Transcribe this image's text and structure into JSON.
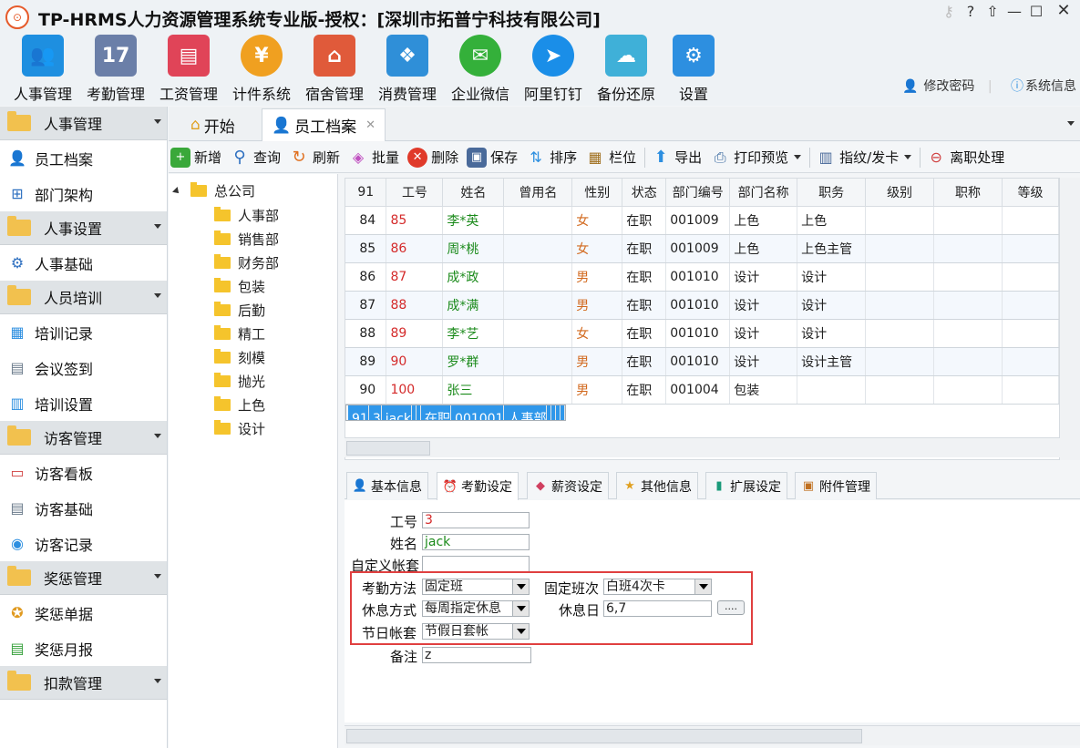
{
  "window": {
    "title": "TP-HRMS人力资源管理系统专业版-授权：[深圳市拓普宁科技有限公司]"
  },
  "modules": [
    {
      "label": "人事管理",
      "icon": "people-icon",
      "color": "#1e8fe0"
    },
    {
      "label": "考勤管理",
      "icon": "calendar-icon",
      "color": "#6b7fa8"
    },
    {
      "label": "工资管理",
      "icon": "payroll-icon",
      "color": "#e04458"
    },
    {
      "label": "计件系统",
      "icon": "moneybag-icon",
      "color": "#f0a020"
    },
    {
      "label": "宿舍管理",
      "icon": "house-icon",
      "color": "#e05a3a"
    },
    {
      "label": "消费管理",
      "icon": "cubes-icon",
      "color": "#2f8fd8"
    },
    {
      "label": "企业微信",
      "icon": "wechat-icon",
      "color": "#34b03a"
    },
    {
      "label": "阿里钉钉",
      "icon": "dingtalk-icon",
      "color": "#1a8ee8"
    },
    {
      "label": "备份还原",
      "icon": "cloud-icon",
      "color": "#3fb0d8"
    },
    {
      "label": "设置",
      "icon": "settings-icon",
      "color": "#2d8fe0"
    }
  ],
  "toplinks": {
    "change_password": "修改密码",
    "system_info": "系统信息"
  },
  "sidebar": {
    "groups": [
      {
        "label": "人事管理",
        "items": [
          {
            "label": "员工档案",
            "icon": "employee-icon"
          },
          {
            "label": "部门架构",
            "icon": "org-chart-icon"
          }
        ]
      },
      {
        "label": "人事设置",
        "items": [
          {
            "label": "人事基础",
            "icon": "gear-icon"
          }
        ]
      },
      {
        "label": "人员培训",
        "items": [
          {
            "label": "培训记录",
            "icon": "training-record-icon"
          },
          {
            "label": "会议签到",
            "icon": "meeting-icon"
          },
          {
            "label": "培训设置",
            "icon": "training-settings-icon"
          }
        ]
      },
      {
        "label": "访客管理",
        "items": [
          {
            "label": "访客看板",
            "icon": "visitor-board-icon"
          },
          {
            "label": "访客基础",
            "icon": "visitor-base-icon"
          },
          {
            "label": "访客记录",
            "icon": "visitor-record-icon"
          }
        ]
      },
      {
        "label": "奖惩管理",
        "items": [
          {
            "label": "奖惩单据",
            "icon": "award-icon"
          },
          {
            "label": "奖惩月报",
            "icon": "report-icon"
          }
        ]
      },
      {
        "label": "扣款管理",
        "items": []
      }
    ]
  },
  "tabs": [
    {
      "label": "开始"
    },
    {
      "label": "员工档案"
    }
  ],
  "toolbar": [
    {
      "label": "新增",
      "icon": "plus-icon"
    },
    {
      "label": "查询",
      "icon": "search-icon"
    },
    {
      "label": "刷新",
      "icon": "refresh-icon"
    },
    {
      "label": "批量",
      "icon": "tag-icon"
    },
    {
      "label": "删除",
      "icon": "delete-icon"
    },
    {
      "label": "保存",
      "icon": "save-icon"
    },
    {
      "label": "排序",
      "icon": "sort-icon"
    },
    {
      "label": "栏位",
      "icon": "columns-icon"
    },
    {
      "label": "导出",
      "icon": "export-icon"
    },
    {
      "label": "打印预览",
      "icon": "print-preview-icon"
    },
    {
      "label": "指纹/发卡",
      "icon": "fingerprint-icon"
    },
    {
      "label": "离职处理",
      "icon": "resign-icon"
    }
  ],
  "tree": {
    "root": "总公司",
    "children": [
      "人事部",
      "销售部",
      "财务部",
      "包装",
      "后勤",
      "精工",
      "刻模",
      "抛光",
      "上色",
      "设计"
    ]
  },
  "grid": {
    "headers": [
      "91",
      "工号",
      "姓名",
      "曾用名",
      "性别",
      "状态",
      "部门编号",
      "部门名称",
      "职务",
      "级别",
      "职称",
      "等级"
    ],
    "rows": [
      [
        "84",
        "85",
        "李*英",
        "",
        "女",
        "在职",
        "001009",
        "上色",
        "上色",
        "",
        "",
        ""
      ],
      [
        "85",
        "86",
        "周*桃",
        "",
        "女",
        "在职",
        "001009",
        "上色",
        "上色主管",
        "",
        "",
        ""
      ],
      [
        "86",
        "87",
        "成*政",
        "",
        "男",
        "在职",
        "001010",
        "设计",
        "设计",
        "",
        "",
        ""
      ],
      [
        "87",
        "88",
        "成*满",
        "",
        "男",
        "在职",
        "001010",
        "设计",
        "设计",
        "",
        "",
        ""
      ],
      [
        "88",
        "89",
        "李*艺",
        "",
        "女",
        "在职",
        "001010",
        "设计",
        "设计",
        "",
        "",
        ""
      ],
      [
        "89",
        "90",
        "罗*群",
        "",
        "男",
        "在职",
        "001010",
        "设计",
        "设计主管",
        "",
        "",
        ""
      ],
      [
        "90",
        "100",
        "张三",
        "",
        "男",
        "在职",
        "001004",
        "包装",
        "",
        "",
        "",
        ""
      ],
      [
        "91",
        "3",
        "jack",
        "",
        "",
        "在职",
        "001001",
        "人事部",
        "",
        "",
        "",
        ""
      ]
    ]
  },
  "subtabs": [
    {
      "label": "基本信息",
      "icon": "user-icon"
    },
    {
      "label": "考勤设定",
      "icon": "alarm-icon"
    },
    {
      "label": "薪资设定",
      "icon": "eraser-icon"
    },
    {
      "label": "其他信息",
      "icon": "star-icon"
    },
    {
      "label": "扩展设定",
      "icon": "book-icon"
    },
    {
      "label": "附件管理",
      "icon": "briefcase-icon"
    }
  ],
  "form": {
    "employee_no": {
      "label": "工号",
      "value": "3"
    },
    "name": {
      "label": "姓名",
      "value": "jack"
    },
    "custom_set": {
      "label": "自定义帐套",
      "value": ""
    },
    "attendance_method": {
      "label": "考勤方法",
      "value": "固定班"
    },
    "fixed_shift": {
      "label": "固定班次",
      "value": "白班4次卡"
    },
    "rest_method": {
      "label": "休息方式",
      "value": "每周指定休息"
    },
    "rest_day": {
      "label": "休息日",
      "value": "6,7"
    },
    "browse_label": "....",
    "holiday_set": {
      "label": "节日帐套",
      "value": "节假日套帐"
    },
    "remark": {
      "label": "备注",
      "value": "z"
    }
  }
}
